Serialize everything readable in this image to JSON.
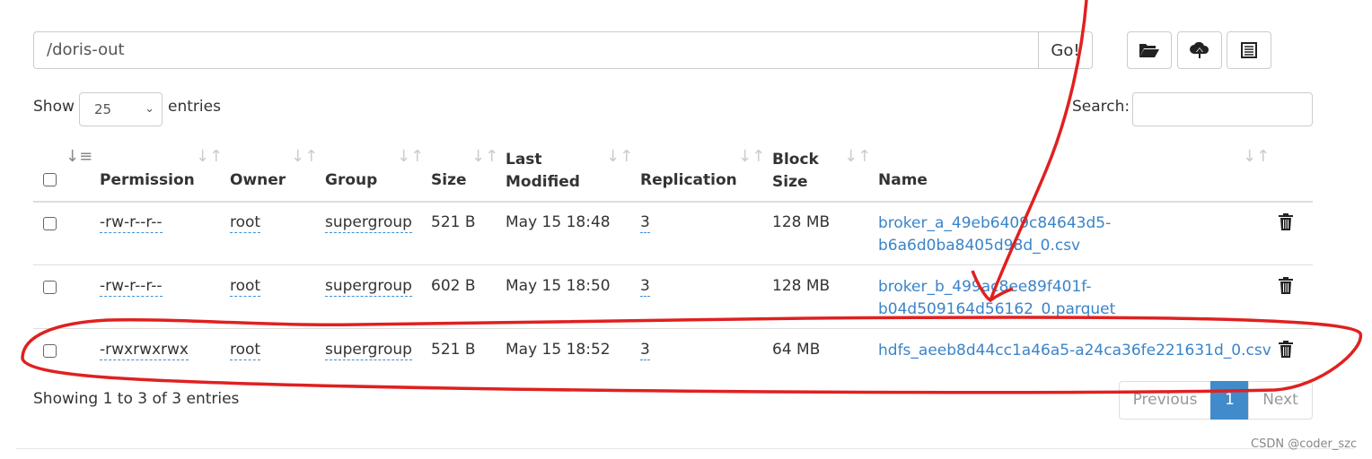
{
  "toolbar": {
    "path": "/doris-out",
    "go_label": "Go!",
    "icons": [
      "folder-open-icon",
      "cloud-upload-icon",
      "list-icon"
    ]
  },
  "length": {
    "show": "Show",
    "value": "25",
    "entries": "entries"
  },
  "search": {
    "label": "Search:",
    "value": ""
  },
  "table": {
    "headers": [
      "Permission",
      "Owner",
      "Group",
      "Size",
      "Last Modified",
      "Replication",
      "Block Size",
      "Name"
    ],
    "header_lines": {
      "last1": "Last",
      "last2": "Modified",
      "block1": "Block",
      "block2": "Size"
    },
    "rows": [
      {
        "permission": "-rw-r--r--",
        "owner": "root",
        "group": "supergroup",
        "size": "521 B",
        "modified": "May 15 18:48",
        "replication": "3",
        "block": "128 MB",
        "name1": "broker_a_49eb6409c84643d5-",
        "name2": "b6a6d0ba8405d98d_0.csv"
      },
      {
        "permission": "-rw-r--r--",
        "owner": "root",
        "group": "supergroup",
        "size": "602 B",
        "modified": "May 15 18:50",
        "replication": "3",
        "block": "128 MB",
        "name1": "broker_b_499ac8ee89f401f-",
        "name2": "b04d509164d56162_0.parquet"
      },
      {
        "permission": "-rwxrwxrwx",
        "owner": "root",
        "group": "supergroup",
        "size": "521 B",
        "modified": "May 15 18:52",
        "replication": "3",
        "block": "64 MB",
        "name1": "hdfs_aeeb8d44cc1a46a5-a24ca36fe221631d_0.csv",
        "name2": ""
      }
    ]
  },
  "info": "Showing 1 to 3 of 3 entries",
  "pagination": {
    "previous": "Previous",
    "page": "1",
    "next": "Next",
    "active_color": "#428bca"
  },
  "watermark": "CSDN @coder_szc",
  "annotation_color": "#e02020"
}
